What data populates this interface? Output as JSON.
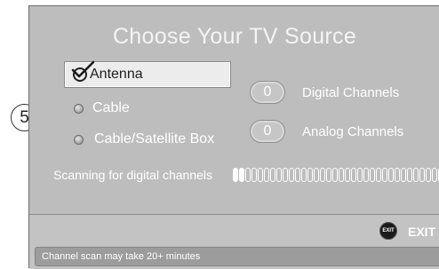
{
  "step": {
    "number": "5"
  },
  "screen": {
    "title": "Choose Your TV Source",
    "sources": [
      {
        "label": "Antenna",
        "selected": true
      },
      {
        "label": "Cable",
        "selected": false
      },
      {
        "label": "Cable/Satellite Box",
        "selected": false
      }
    ],
    "counters": [
      {
        "value": "0",
        "label": "Digital Channels"
      },
      {
        "value": "0",
        "label": "Analog Channels"
      }
    ],
    "scan": {
      "label": "Scanning for digital channels",
      "progress_segments_filled": 2
    },
    "footer": {
      "exit_icon_text": "EXIT",
      "exit_label": "EXIT",
      "status_message": "Channel scan may take 20+ minutes"
    }
  },
  "colors": {
    "screen_background": "#bdbdbd",
    "text": "#ffffff",
    "selected_row": "#ececec"
  }
}
